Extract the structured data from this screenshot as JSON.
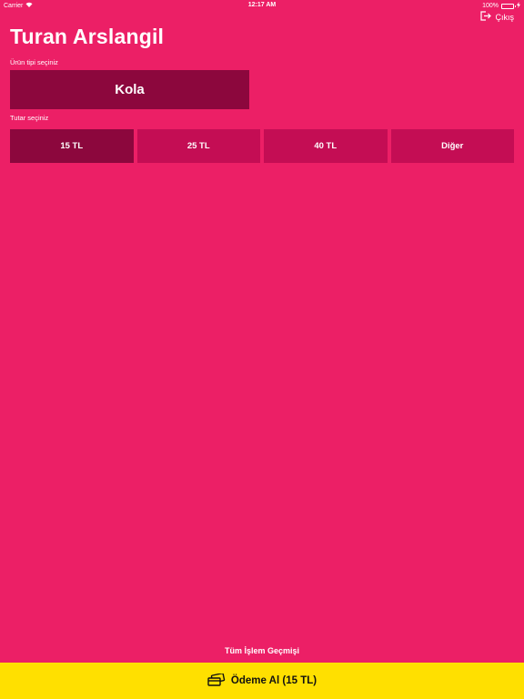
{
  "status_bar": {
    "carrier": "Carrier",
    "time": "12:17 AM",
    "battery": "100%"
  },
  "header": {
    "title": "Turan Arslangil",
    "logout_label": "Çıkış"
  },
  "product": {
    "label": "Ürün tipi seçiniz",
    "selected": "Kola"
  },
  "amount": {
    "label": "Tutar seçiniz",
    "options": [
      "15 TL",
      "25 TL",
      "40 TL",
      "Diğer"
    ],
    "selected_index": 0
  },
  "footer": {
    "history_link": "Tüm İşlem Geçmişi",
    "pay_button": "Ödeme Al (15 TL)"
  },
  "colors": {
    "background": "#EC1F66",
    "selected": "#8C073D",
    "unselected": "#C40D54",
    "pay_bar": "#FFE000"
  }
}
